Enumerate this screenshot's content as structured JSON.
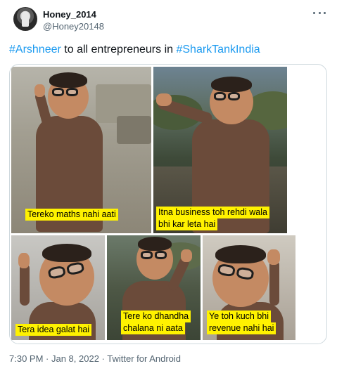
{
  "tweet": {
    "display_name": "Honey_2014",
    "handle": "@Honey20148",
    "text_parts": {
      "hashtag_1": "#Arshneer",
      "middle": " to all entrepreneurs in ",
      "hashtag_2": "#SharkTankIndia"
    },
    "media": {
      "captions": {
        "panel_1": "Tereko maths nahi aati",
        "panel_2_line_1": "Itna business toh rehdi wala",
        "panel_2_line_2": "bhi kar leta hai",
        "panel_3": "Tera idea galat hai",
        "panel_4_line_1": "Tere ko dhandha",
        "panel_4_line_2": "chalana ni aata",
        "panel_5_line_1": "Ye toh kuch bhi",
        "panel_5_line_2": "revenue nahi hai"
      }
    },
    "footer": {
      "time": "7:30 PM",
      "sep_1": " · ",
      "date": "Jan 8, 2022",
      "sep_2": " · ",
      "source": "Twitter for Android"
    }
  },
  "colors": {
    "link": "#1d9bf0",
    "secondary_text": "#536471",
    "caption_bg": "#fff200"
  },
  "icons": {
    "more": "more-horizontal-icon"
  }
}
